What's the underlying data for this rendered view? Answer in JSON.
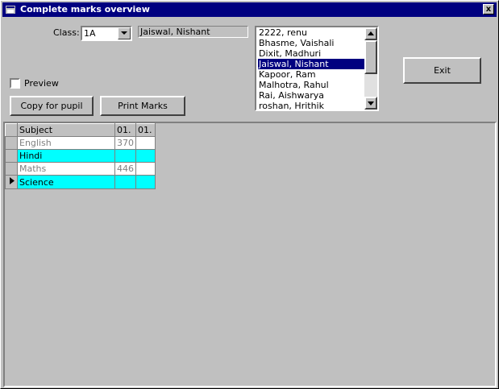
{
  "window": {
    "title": "Complete marks overview",
    "close_label": "x"
  },
  "class_label": "Class:",
  "class_combo": {
    "value": "1A"
  },
  "selected_pupil": "Jaiswal, Nishant",
  "pupil_list": {
    "items": [
      "2222, renu",
      "Bhasme, Vaishali",
      "Dixit, Madhuri",
      "Jaiswal, Nishant",
      "Kapoor, Ram",
      "Malhotra, Rahul",
      "Rai, Aishwarya",
      "roshan, Hrithik"
    ],
    "selected_index": 3
  },
  "exit_button": "Exit",
  "preview_label": "Preview",
  "copy_button": "Copy for pupil",
  "print_button": "Print Marks",
  "grid": {
    "headers": [
      "Subject",
      "01.",
      "01."
    ],
    "rows": [
      {
        "subject": "English",
        "m1": "370",
        "m2": ""
      },
      {
        "subject": "Hindi",
        "m1": "",
        "m2": ""
      },
      {
        "subject": "Maths",
        "m1": "446",
        "m2": ""
      },
      {
        "subject": "Science",
        "m1": "",
        "m2": ""
      }
    ],
    "current_row": 3
  }
}
